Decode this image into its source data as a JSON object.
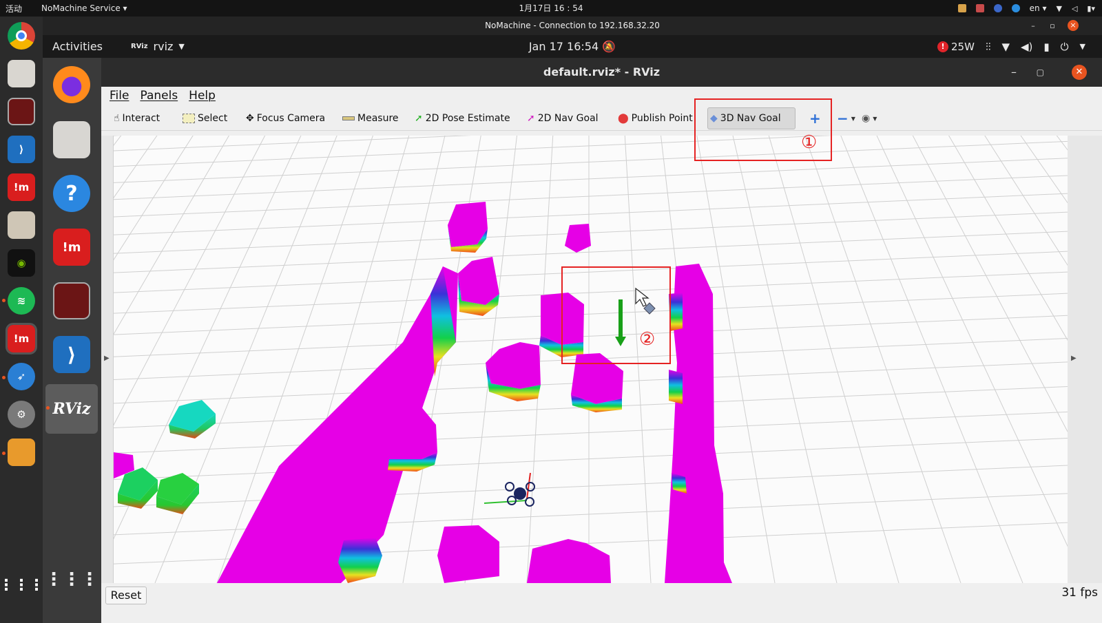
{
  "host_bar": {
    "activities": "活动",
    "service_menu": "NoMachine Service ▾",
    "clock": "1月17日  16 : 54",
    "lang": "en ▾"
  },
  "nomachine": {
    "title": "NoMachine - Connection to 192.168.32.20"
  },
  "gnome_bar": {
    "activities": "Activities",
    "app_name": "rviz",
    "app_icon_text": "RViz",
    "clock": "Jan 17  16:54",
    "power_label": "25W"
  },
  "inner_dock": {
    "rviz_label": "RViz"
  },
  "window": {
    "title": "default.rviz* - RViz",
    "menu": {
      "file": "File",
      "panels": "Panels",
      "help": "Help"
    }
  },
  "toolbar": {
    "interact": "Interact",
    "select": "Select",
    "focus_camera": "Focus Camera",
    "measure": "Measure",
    "pose_estimate": "2D Pose Estimate",
    "nav_goal": "2D Nav Goal",
    "publish_point": "Publish Point",
    "nav_goal_3d": "3D Nav Goal"
  },
  "annotations": {
    "one": "①",
    "two": "②"
  },
  "status": {
    "reset": "Reset",
    "fps": "31 fps"
  },
  "colors": {
    "voxel_top": "#e800e8",
    "annotation_red": "#e52222",
    "ubuntu_orange": "#e95420"
  }
}
